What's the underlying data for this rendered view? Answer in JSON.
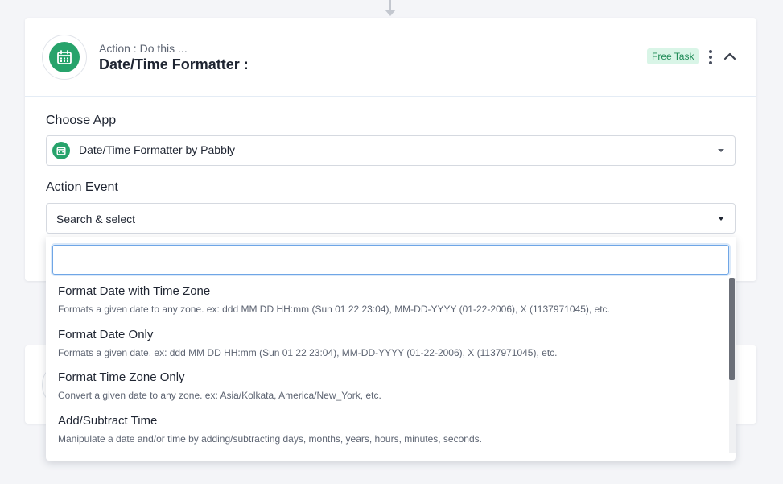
{
  "header": {
    "subtitle": "Action : Do this ...",
    "title": "Date/Time Formatter :",
    "badge": "Free Task"
  },
  "choose_app": {
    "label": "Choose App",
    "selected": "Date/Time Formatter by Pabbly"
  },
  "action_event": {
    "label": "Action Event",
    "placeholder": "Search & select",
    "search_value": ""
  },
  "dropdown": {
    "items": [
      {
        "title": "Format Date with Time Zone",
        "desc": "Formats a given date to any zone. ex: ddd MM DD HH:mm (Sun 01 22 23:04), MM-DD-YYYY (01-22-2006), X (1137971045), etc."
      },
      {
        "title": "Format Date Only",
        "desc": "Formats a given date. ex: ddd MM DD HH:mm (Sun 01 22 23:04), MM-DD-YYYY (01-22-2006), X (1137971045), etc."
      },
      {
        "title": "Format Time Zone Only",
        "desc": "Convert a given date to any zone. ex: Asia/Kolkata, America/New_York, etc."
      },
      {
        "title": "Add/Subtract Time",
        "desc": "Manipulate a date and/or time by adding/subtracting days, months, years, hours, minutes, seconds."
      }
    ]
  },
  "icons": {
    "app": "calendar-icon",
    "menu": "kebab-menu-icon",
    "collapse": "chevron-up-icon",
    "caret": "caret-down-icon"
  },
  "colors": {
    "brand_green": "#27a36b",
    "badge_bg": "#d9f5e7",
    "badge_text": "#1e8a56",
    "focus_blue": "#6fa6e6"
  }
}
